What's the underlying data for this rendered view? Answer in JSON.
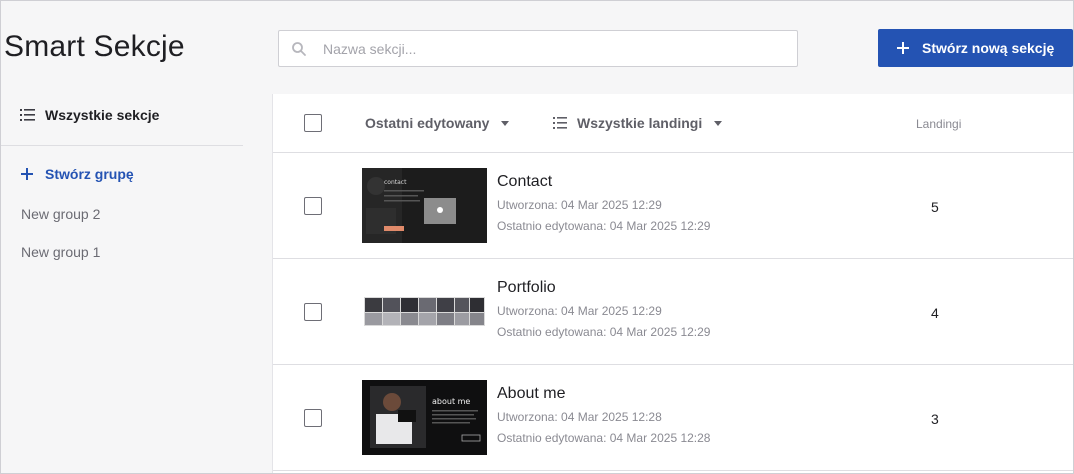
{
  "header": {
    "title": "Smart Sekcje",
    "search_placeholder": "Nazwa sekcji...",
    "create_button": "Stwórz nową sekcję"
  },
  "sidebar": {
    "all_sections": "Wszystkie sekcje",
    "create_group": "Stwórz grupę",
    "groups": [
      "New group 2",
      "New group 1"
    ]
  },
  "table": {
    "sort_label": "Ostatni edytowany",
    "filter_label": "Wszystkie landingi",
    "col_landings": "Landingi",
    "rows": [
      {
        "name": "Contact",
        "created": "Utworzona: 04 Mar 2025 12:29",
        "edited": "Ostatnio edytowana: 04 Mar 2025 12:29",
        "landings": "5",
        "thumb_text": "contact"
      },
      {
        "name": "Portfolio",
        "created": "Utworzona: 04 Mar 2025 12:29",
        "edited": "Ostatnio edytowana: 04 Mar 2025 12:29",
        "landings": "4",
        "thumb_text": ""
      },
      {
        "name": "About me",
        "created": "Utworzona: 04 Mar 2025 12:28",
        "edited": "Ostatnio edytowana: 04 Mar 2025 12:28",
        "landings": "3",
        "thumb_text": "about me"
      }
    ]
  },
  "colors": {
    "accent": "#2453b3",
    "page_bg": "#f6f6f7",
    "muted_text": "#8a8a92"
  }
}
